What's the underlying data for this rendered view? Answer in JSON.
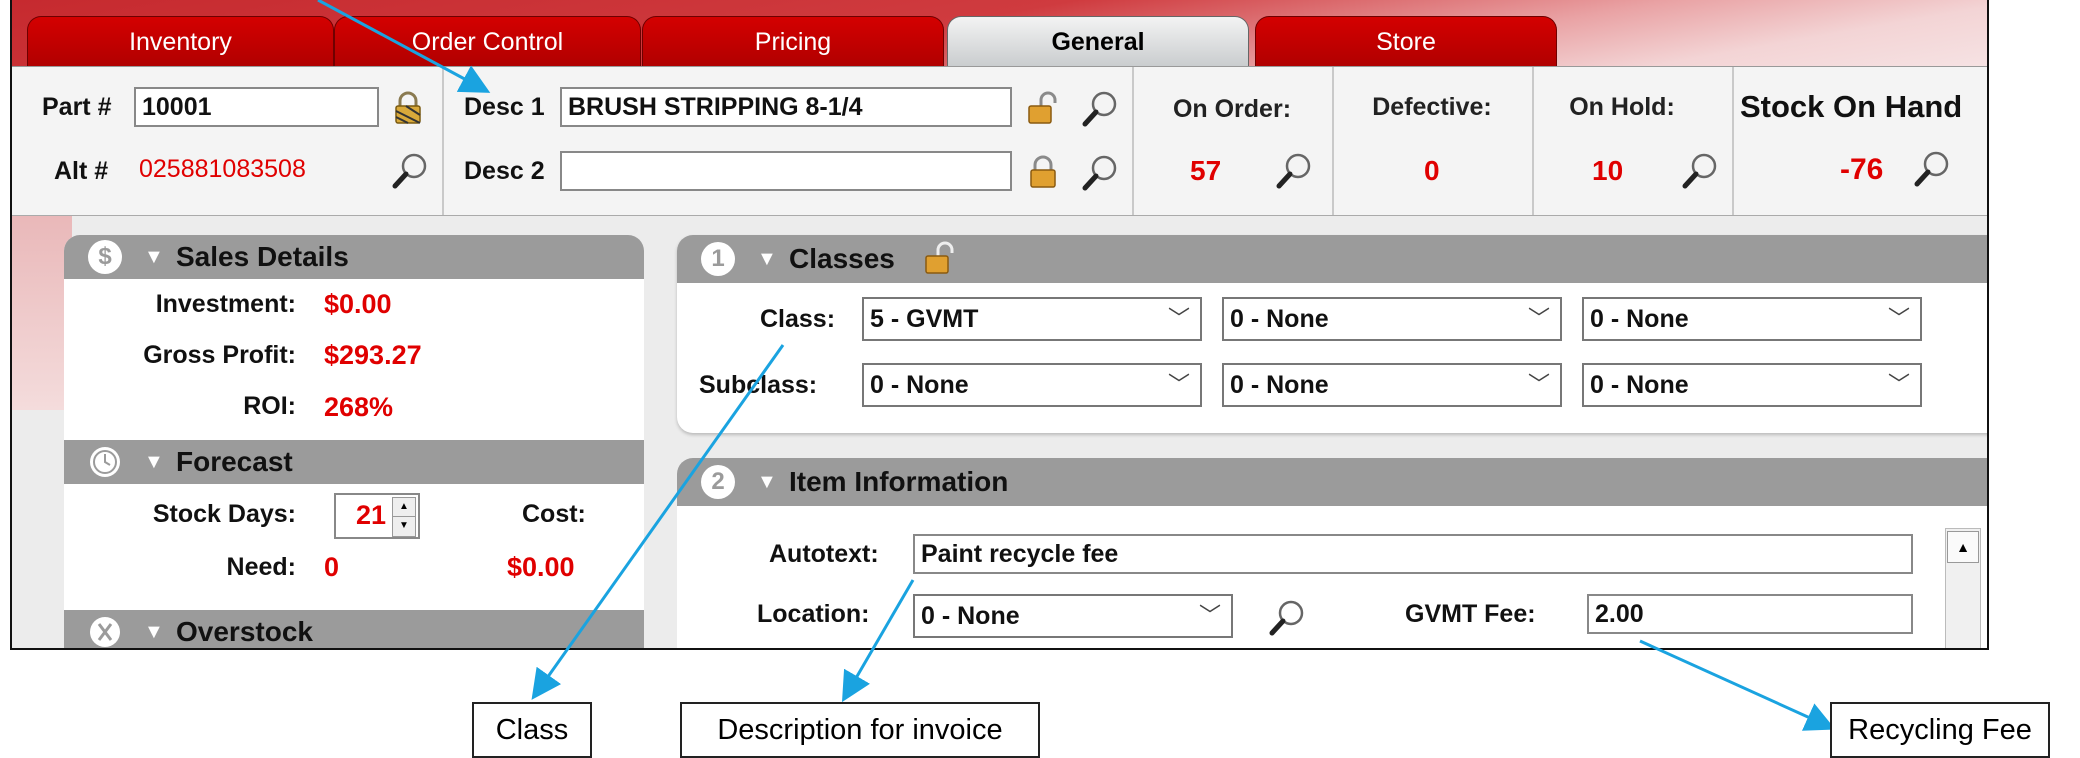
{
  "tabs": [
    "Inventory",
    "Order Control",
    "Pricing",
    "General",
    "Store"
  ],
  "active_tab": "General",
  "part": {
    "label": "Part #",
    "value": "10001"
  },
  "alt": {
    "label": "Alt #",
    "value": "025881083508"
  },
  "desc1": {
    "label": "Desc 1",
    "value": "BRUSH STRIPPING 8-1/4"
  },
  "desc2": {
    "label": "Desc 2",
    "value": ""
  },
  "on_order": {
    "label": "On Order:",
    "value": "57"
  },
  "defective": {
    "label": "Defective:",
    "value": "0"
  },
  "on_hold": {
    "label": "On Hold:",
    "value": "10"
  },
  "stock_on_hand": {
    "label": "Stock On Hand",
    "value": "-76"
  },
  "sales_details": {
    "title": "Sales Details",
    "icon_glyph": "$",
    "investment_label": "Investment:",
    "investment": "$0.00",
    "gross_profit_label": "Gross Profit:",
    "gross_profit": "$293.27",
    "roi_label": "ROI:",
    "roi": "268%"
  },
  "forecast": {
    "title": "Forecast",
    "stock_days_label": "Stock Days:",
    "stock_days": "21",
    "cost_label": "Cost:",
    "cost": "$0.00",
    "need_label": "Need:",
    "need": "0"
  },
  "overstock": {
    "title": "Overstock"
  },
  "classes": {
    "number": "1",
    "title": "Classes",
    "class_label": "Class:",
    "subclass_label": "Subclass:",
    "class_values": [
      "5 - GVMT",
      "0 - None",
      "0 - None"
    ],
    "subclass_values": [
      "0 - None",
      "0 - None",
      "0 - None"
    ]
  },
  "item_information": {
    "number": "2",
    "title": "Item Information",
    "autotext_label": "Autotext:",
    "autotext": "Paint recycle fee",
    "location_label": "Location:",
    "location": "0 - None",
    "gvmt_fee_label": "GVMT Fee:",
    "gvmt_fee": "2.00"
  },
  "callouts": {
    "class": "Class",
    "description": "Description for invoice",
    "recycling": "Recycling Fee"
  },
  "colors": {
    "tab_red": "#c00000",
    "value_red": "#e00000",
    "callout_blue": "#1aa3e0",
    "section_gray": "#9b9b9b"
  }
}
